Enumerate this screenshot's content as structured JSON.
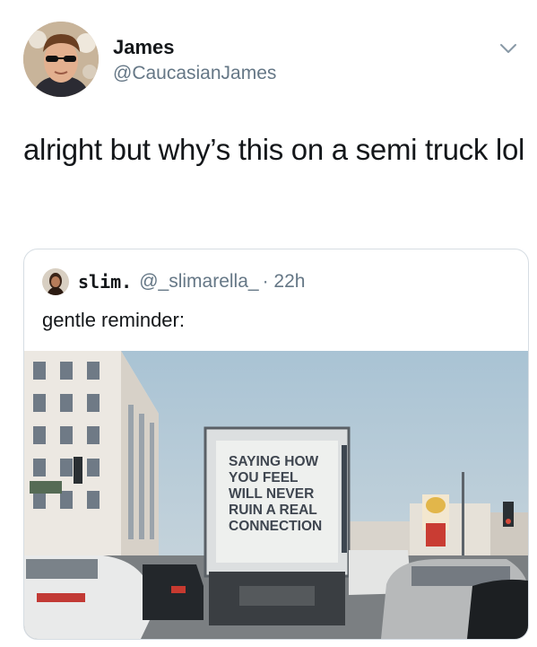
{
  "author": {
    "name": "James",
    "handle": "@CaucasianJames"
  },
  "tweet": {
    "text": "alright but why’s this on a semi truck lol"
  },
  "quote": {
    "name": "slim.",
    "handle": "@_slimarella_",
    "time": "· 22h",
    "text": "gentle reminder:",
    "photo": {
      "truck_sign_lines": [
        "SAYING HOW",
        "YOU FEEL",
        "WILL NEVER",
        "RUIN A REAL",
        "CONNECTION"
      ]
    }
  },
  "icons": {
    "more": "chevron-down-icon"
  }
}
